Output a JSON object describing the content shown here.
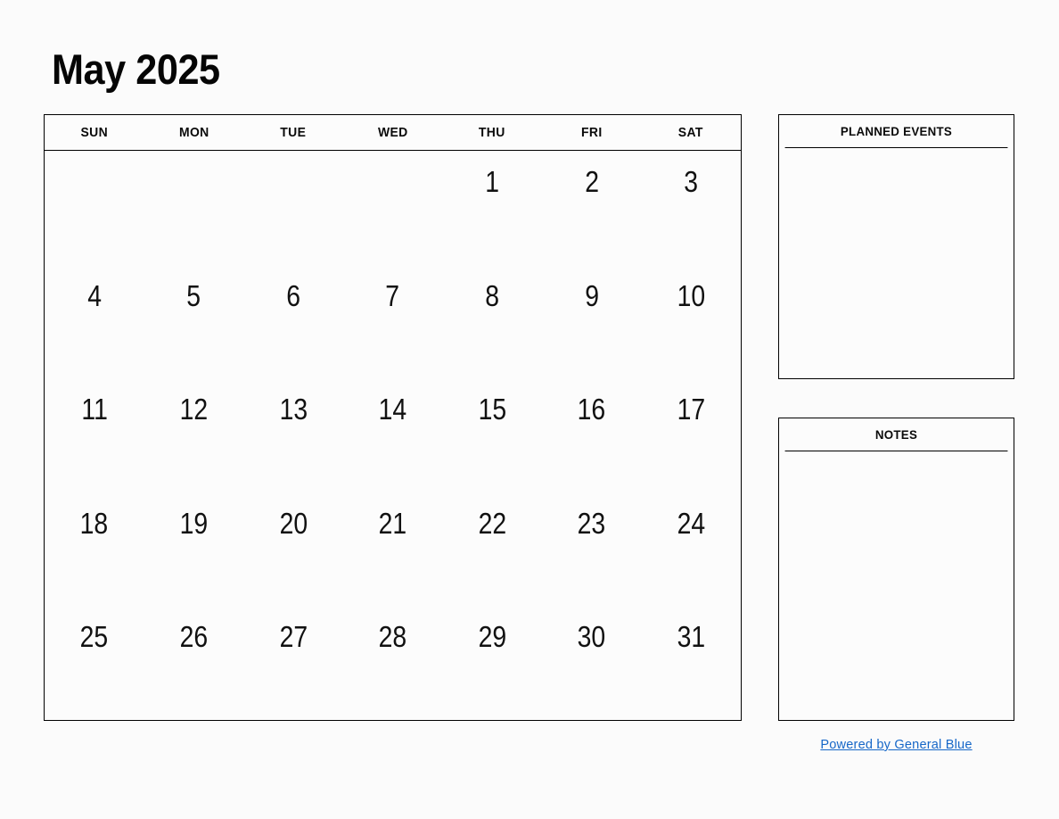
{
  "calendar": {
    "title": "May 2025",
    "month": "May",
    "year": "2025",
    "weekday_headers": [
      "SUN",
      "MON",
      "TUE",
      "WED",
      "THU",
      "FRI",
      "SAT"
    ],
    "weeks": [
      [
        "",
        "",
        "",
        "",
        "1",
        "2",
        "3"
      ],
      [
        "4",
        "5",
        "6",
        "7",
        "8",
        "9",
        "10"
      ],
      [
        "11",
        "12",
        "13",
        "14",
        "15",
        "16",
        "17"
      ],
      [
        "18",
        "19",
        "20",
        "21",
        "22",
        "23",
        "24"
      ],
      [
        "25",
        "26",
        "27",
        "28",
        "29",
        "30",
        "31"
      ]
    ]
  },
  "panels": {
    "planned_events": {
      "title": "PLANNED EVENTS",
      "content": ""
    },
    "notes": {
      "title": "NOTES",
      "content": ""
    }
  },
  "footer": {
    "link_label": "Powered by General Blue",
    "link_color": "#1667c8"
  },
  "colors": {
    "background": "#fbfbfb",
    "surface": "#fcfcfc",
    "border": "#000000",
    "text": "#0a0a0a",
    "link": "#1667c8"
  }
}
